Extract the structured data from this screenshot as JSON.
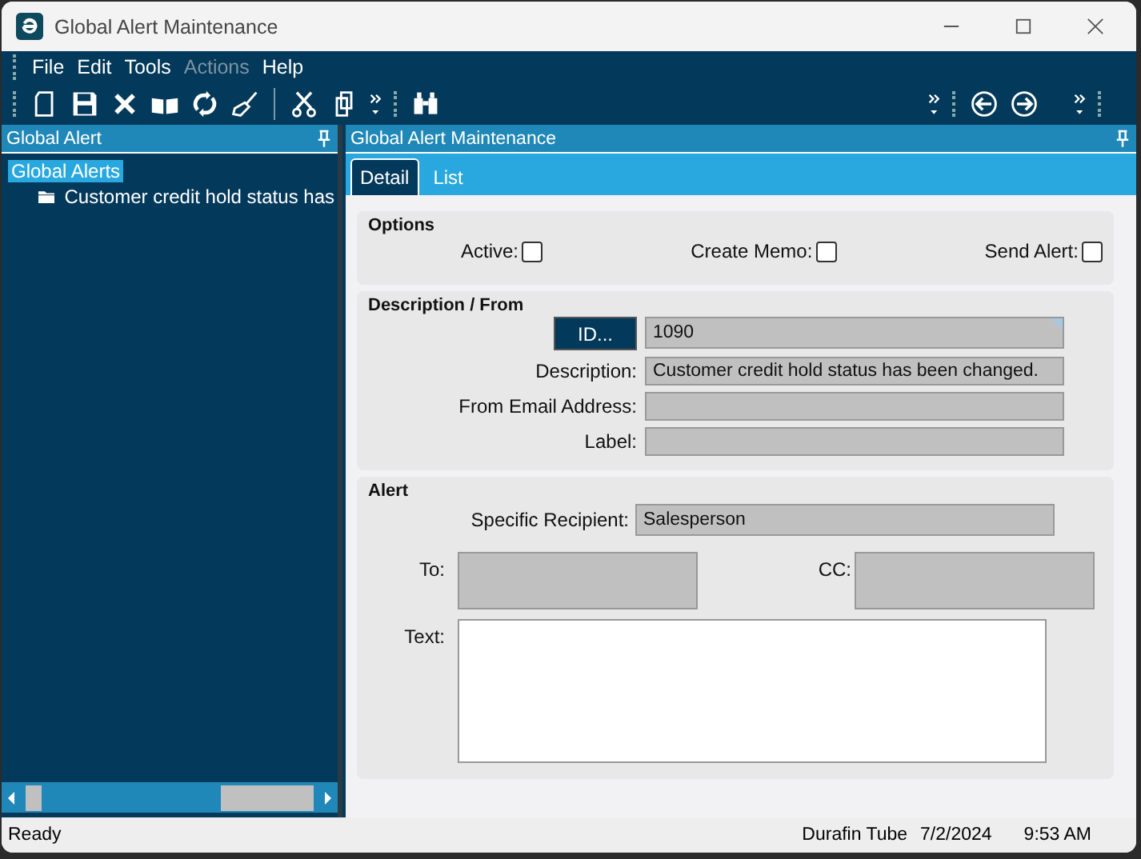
{
  "window": {
    "title": "Global Alert Maintenance"
  },
  "menu": [
    {
      "label": "File",
      "disabled": false
    },
    {
      "label": "Edit",
      "disabled": false
    },
    {
      "label": "Tools",
      "disabled": false
    },
    {
      "label": "Actions",
      "disabled": true
    },
    {
      "label": "Help",
      "disabled": false
    }
  ],
  "left_panel": {
    "title": "Global Alert",
    "tree": [
      {
        "label": "Global Alerts",
        "selected": true,
        "children": [
          {
            "label": "Customer credit hold status has",
            "selected": false
          }
        ]
      }
    ]
  },
  "right_panel": {
    "title": "Global Alert Maintenance",
    "tabs": [
      {
        "label": "Detail",
        "selected": true
      },
      {
        "label": "List",
        "selected": false
      }
    ],
    "options": {
      "title": "Options",
      "checkboxes": [
        {
          "label": "Active:",
          "checked": false
        },
        {
          "label": "Create Memo:",
          "checked": false
        },
        {
          "label": "Send Alert:",
          "checked": false
        }
      ]
    },
    "description": {
      "title": "Description / From",
      "id_button": "ID...",
      "id_value": "1090",
      "fields": [
        {
          "label": "Description:",
          "value": "Customer credit hold status has been changed."
        },
        {
          "label": "From Email Address:"
        },
        {
          "label": "Label:"
        }
      ]
    },
    "alert": {
      "title": "Alert",
      "recipient_label": "Specific Recipient:",
      "recipient_value": "Salesperson",
      "to_label": "To:",
      "cc_label": "CC:",
      "text_label": "Text:"
    }
  },
  "status_bar": {
    "status": "Ready",
    "company": "Durafin Tube",
    "date": "7/2/2024",
    "time": "9:53 AM"
  }
}
